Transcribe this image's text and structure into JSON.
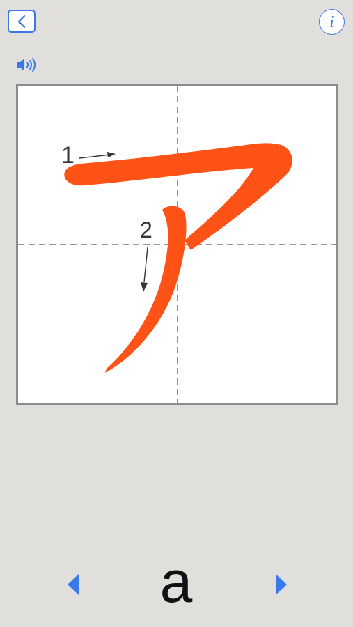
{
  "header": {
    "back_icon": "chevron-left-icon",
    "info_label": "i"
  },
  "sound": {
    "icon": "speaker-icon"
  },
  "character": {
    "strokes": [
      {
        "number": "1",
        "direction": "right"
      },
      {
        "number": "2",
        "direction": "down"
      }
    ]
  },
  "navigation": {
    "romaji": "a",
    "prev_icon": "triangle-left-icon",
    "next_icon": "triangle-right-icon"
  },
  "colors": {
    "accent": "#3b78e7",
    "stroke": "#ff5216",
    "background": "#e1dfdb",
    "panel": "#ffffff"
  }
}
